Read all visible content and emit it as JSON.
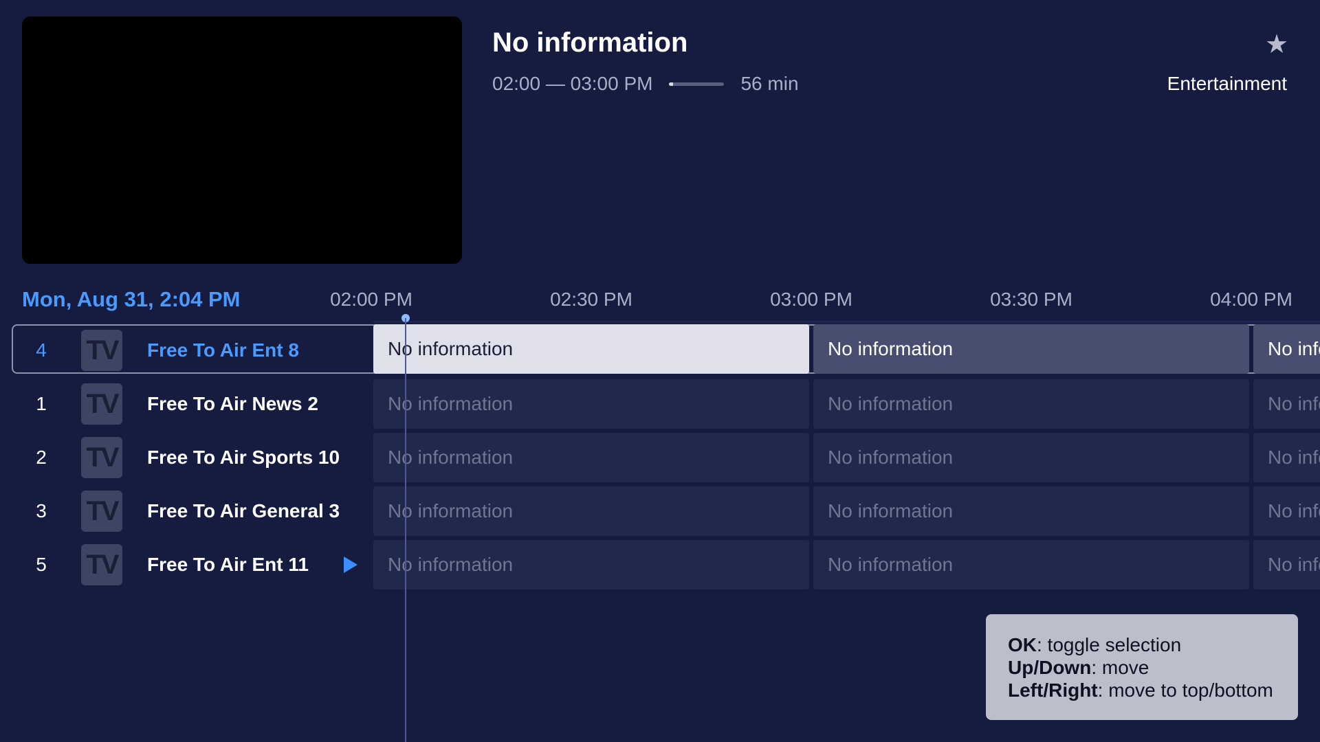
{
  "program": {
    "title": "No information",
    "time_range": "02:00 — 03:00 PM",
    "duration": "56 min",
    "progress_fraction": 0.07,
    "genre": "Entertainment",
    "favorite_icon": "star-icon"
  },
  "guide": {
    "current_datetime": "Mon, Aug 31, 2:04 PM",
    "time_slots": [
      "02:00 PM",
      "02:30 PM",
      "03:00 PM",
      "03:30 PM",
      "04:00 PM"
    ],
    "channels": [
      {
        "number": "4",
        "logo": "TV",
        "name": "Free To Air Ent 8",
        "programs": [
          "No information",
          "No information",
          "No information"
        ]
      },
      {
        "number": "1",
        "logo": "TV",
        "name": "Free To Air News 2",
        "programs": [
          "No information",
          "No information",
          "No information"
        ]
      },
      {
        "number": "2",
        "logo": "TV",
        "name": "Free To Air Sports 10",
        "programs": [
          "No information",
          "No information",
          "No information"
        ]
      },
      {
        "number": "3",
        "logo": "TV",
        "name": "Free To Air General 3",
        "programs": [
          "No information",
          "No information",
          "No information"
        ]
      },
      {
        "number": "5",
        "logo": "TV",
        "name": "Free To Air Ent 11",
        "programs": [
          "No information",
          "No information",
          "No information"
        ],
        "playing_icon": "play-icon"
      }
    ]
  },
  "hints": [
    {
      "key": "OK",
      "text": ": toggle selection"
    },
    {
      "key": "Up/Down",
      "text": ": move"
    },
    {
      "key": "Left/Right",
      "text": ": move to top/bottom"
    }
  ],
  "colors": {
    "background": "#161c40",
    "accent": "#4a9bff",
    "focused_cell": "#dfe0ea"
  }
}
